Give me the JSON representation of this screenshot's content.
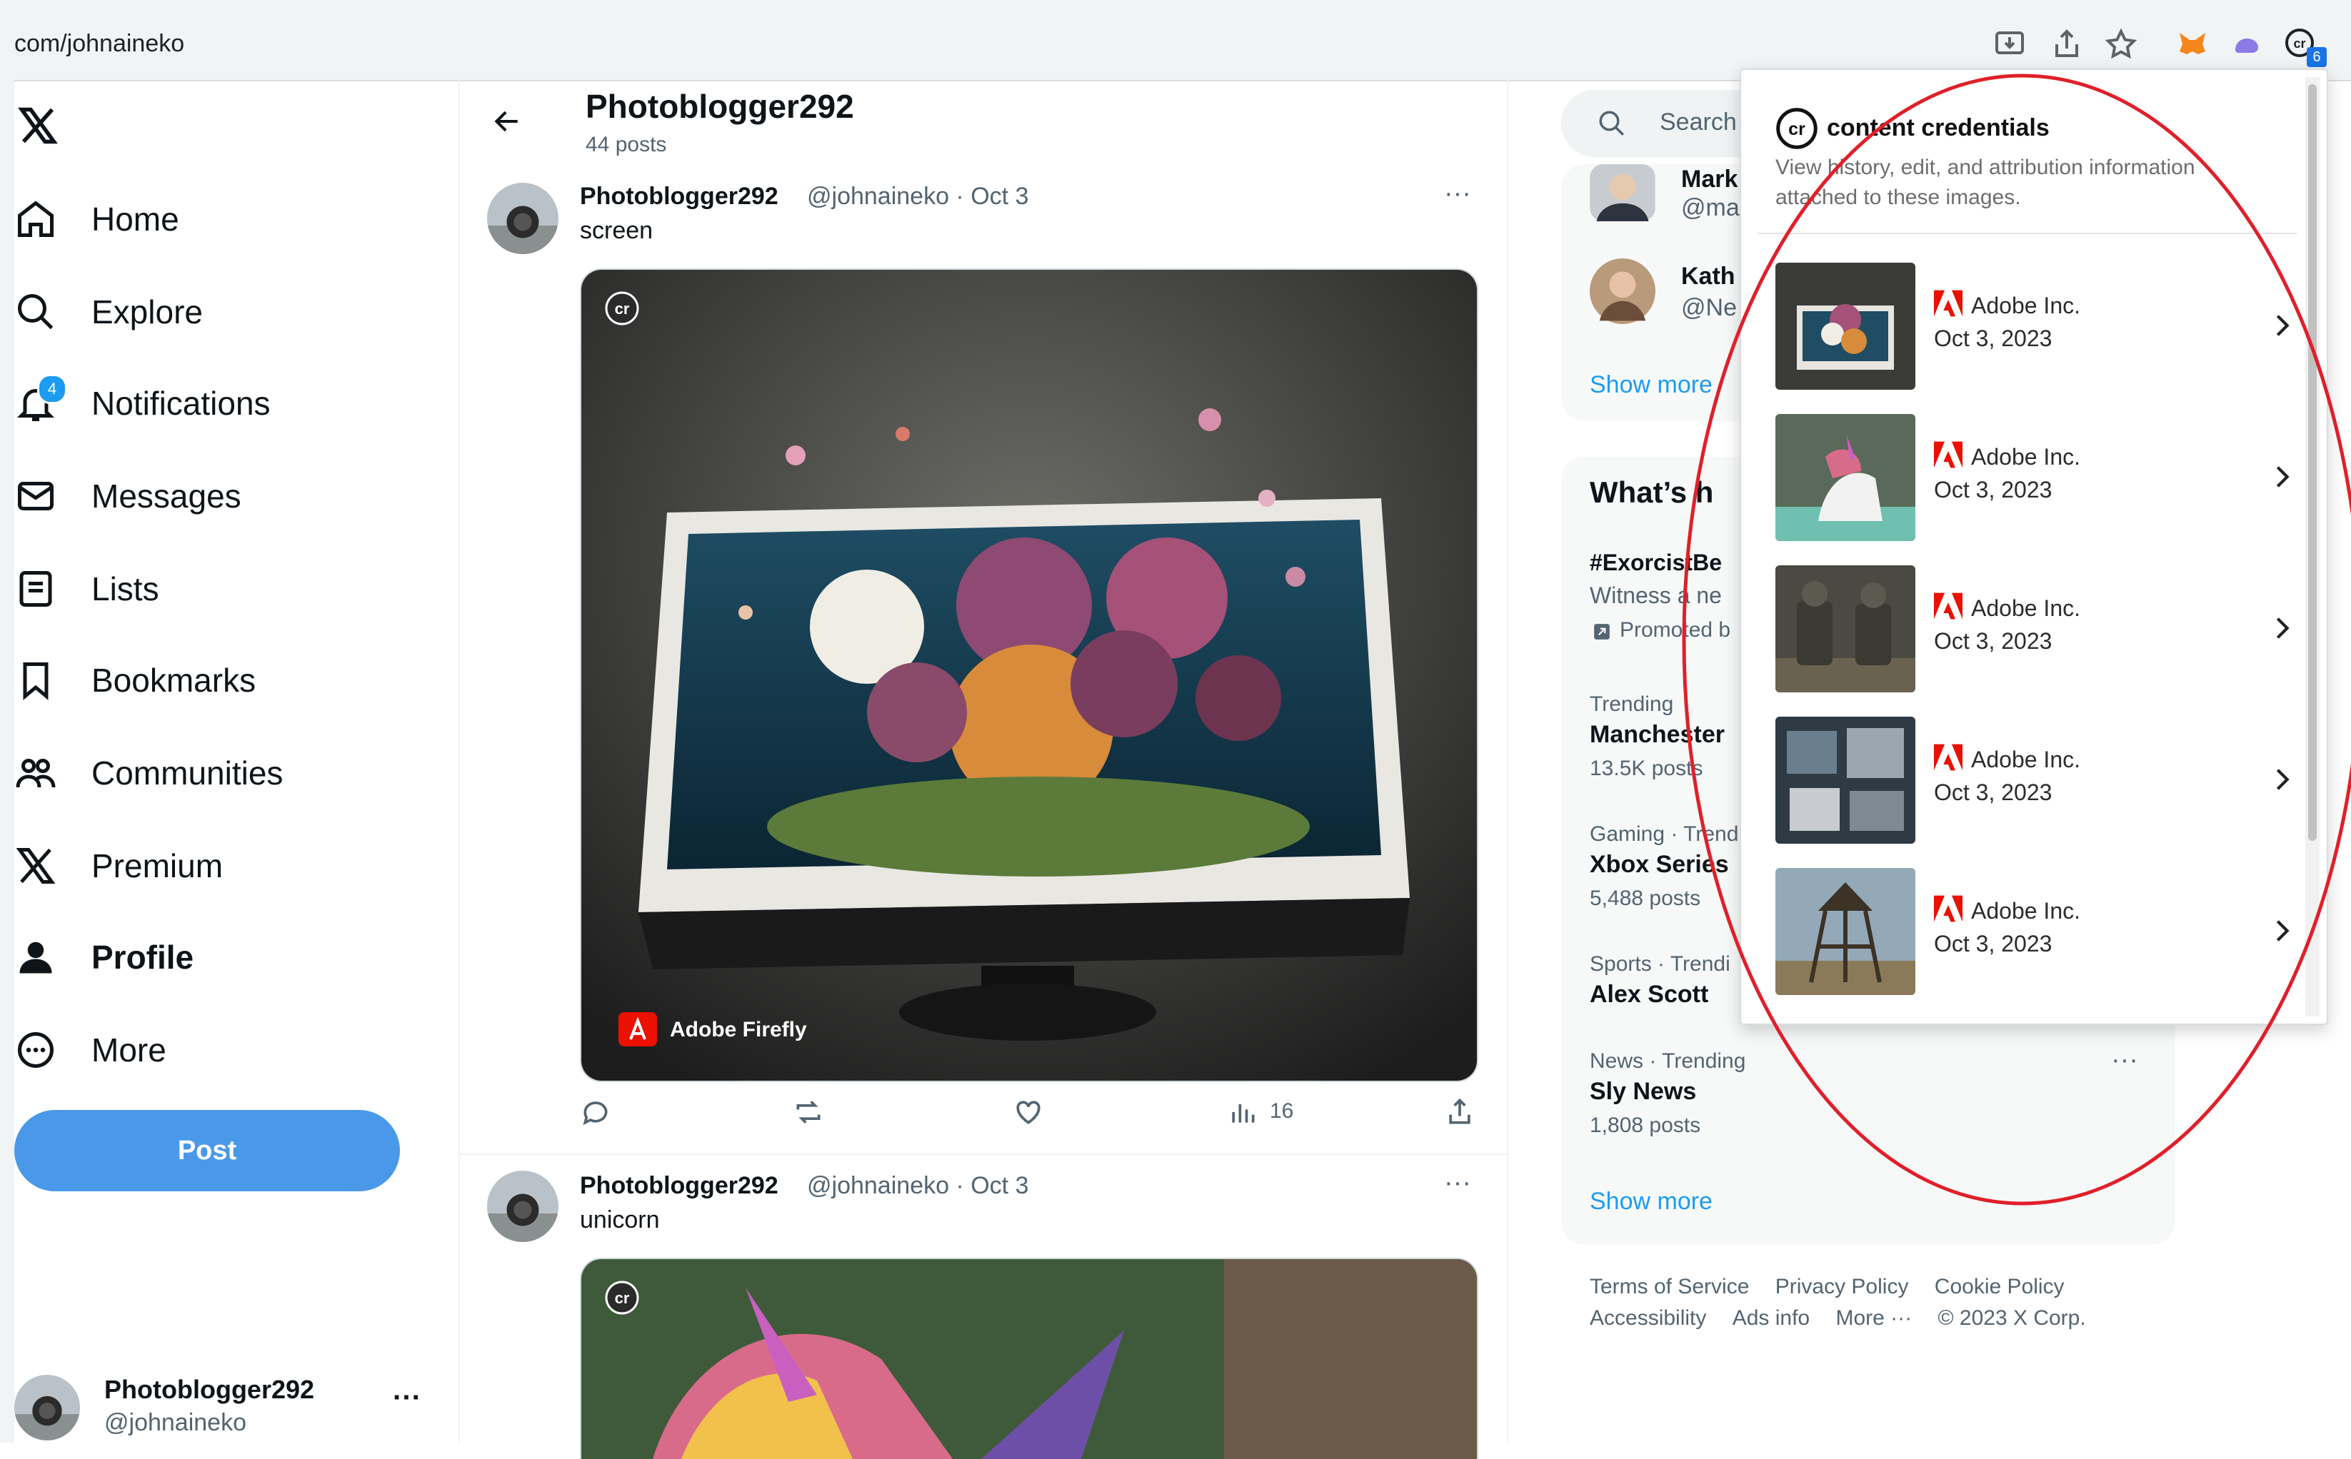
{
  "browser": {
    "url": "com/johnaineko",
    "extension_badge": "6"
  },
  "nav": {
    "items": [
      {
        "label": "Home",
        "icon": "home-icon"
      },
      {
        "label": "Explore",
        "icon": "search-icon"
      },
      {
        "label": "Notifications",
        "icon": "bell-icon",
        "badge": "4"
      },
      {
        "label": "Messages",
        "icon": "mail-icon"
      },
      {
        "label": "Lists",
        "icon": "list-icon"
      },
      {
        "label": "Bookmarks",
        "icon": "bookmark-icon"
      },
      {
        "label": "Communities",
        "icon": "people-icon"
      },
      {
        "label": "Premium",
        "icon": "x-logo-icon"
      },
      {
        "label": "Profile",
        "icon": "person-icon"
      },
      {
        "label": "More",
        "icon": "more-circle-icon"
      }
    ],
    "post_label": "Post"
  },
  "account": {
    "name": "Photoblogger292",
    "handle": "@johnaineko"
  },
  "profile_header": {
    "name": "Photoblogger292",
    "posts": "44 posts"
  },
  "tweets": [
    {
      "name": "Photoblogger292",
      "meta": "@johnaineko · Oct 3",
      "text": "screen",
      "watermark": "Adobe Firefly",
      "views": "16"
    },
    {
      "name": "Photoblogger292",
      "meta": "@johnaineko · Oct 3",
      "text": "unicorn"
    }
  ],
  "right": {
    "search_placeholder": "Search",
    "follow": [
      {
        "name": "Mark",
        "handle": "@ma"
      },
      {
        "name": "Kath",
        "handle": "@Ne"
      }
    ],
    "show_more_1": "Show more",
    "trends_title": "What’s h",
    "trends": [
      {
        "name": "#ExorcistBe",
        "desc": "Witness a ne",
        "promo": "Promoted b"
      },
      {
        "context": "Trending",
        "name": "Manchester",
        "count": "13.5K posts"
      },
      {
        "context": "Gaming · Trend",
        "name": "Xbox Series",
        "count": "5,488 posts"
      },
      {
        "context": "Sports · Trendi",
        "name": "Alex Scott"
      },
      {
        "context": "News · Trending",
        "name": "Sly News",
        "count": "1,808 posts"
      }
    ],
    "show_more_2": "Show more",
    "footer": {
      "line1": [
        "Terms of Service",
        "Privacy Policy",
        "Cookie Policy"
      ],
      "line2": [
        "Accessibility",
        "Ads info",
        "More ···",
        "© 2023 X Corp."
      ]
    }
  },
  "popup": {
    "title": "content credentials",
    "description_1": "View history, edit, and attribution information",
    "description_2": "attached to these images.",
    "items": [
      {
        "company": "Adobe Inc.",
        "date": "Oct 3, 2023"
      },
      {
        "company": "Adobe Inc.",
        "date": "Oct 3, 2023"
      },
      {
        "company": "Adobe Inc.",
        "date": "Oct 3, 2023"
      },
      {
        "company": "Adobe Inc.",
        "date": "Oct 3, 2023"
      },
      {
        "company": "Adobe Inc.",
        "date": "Oct 3, 2023"
      }
    ]
  },
  "colors": {
    "accent": "#1d9bf0",
    "post_button": "#4a99e9",
    "annotation_ellipse": "#e0202a",
    "adobe_red": "#eb1000"
  }
}
